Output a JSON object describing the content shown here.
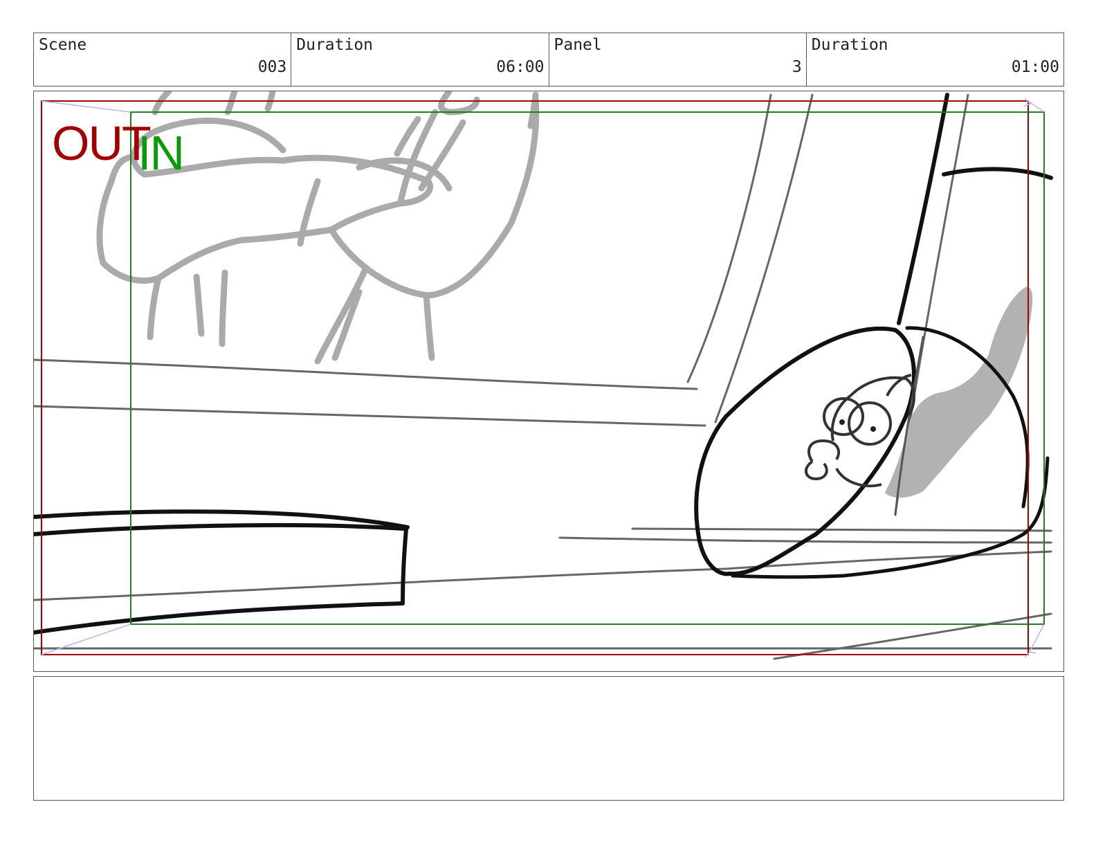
{
  "header": {
    "scene_label": "Scene",
    "scene_value": "003",
    "scene_duration_label": "Duration",
    "scene_duration_value": "06:00",
    "panel_label": "Panel",
    "panel_value": "3",
    "panel_duration_label": "Duration",
    "panel_duration_value": "01:00"
  },
  "frame": {
    "out_label": "OUT",
    "in_label": "IN",
    "out_color": "#a30000",
    "in_color": "#0a9a0a"
  },
  "notes": {
    "text": ""
  }
}
